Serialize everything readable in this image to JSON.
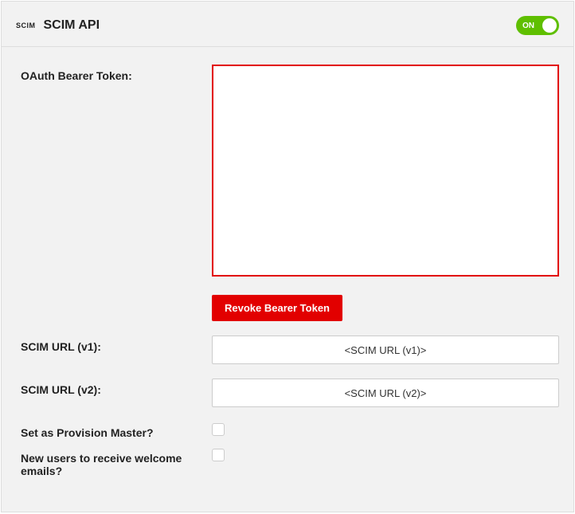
{
  "header": {
    "icon_text": "SCIM",
    "title": "SCIM API",
    "toggle": {
      "label": "ON",
      "on": true
    }
  },
  "form": {
    "token": {
      "label": "OAuth Bearer Token:",
      "value": "",
      "revoke_button": "Revoke Bearer Token"
    },
    "url_v1": {
      "label": "SCIM URL (v1):",
      "value": "<SCIM URL (v1)>"
    },
    "url_v2": {
      "label": "SCIM URL (v2):",
      "value": "<SCIM URL (v2)>"
    },
    "provision_master": {
      "label": "Set as Provision Master?",
      "checked": false
    },
    "welcome_emails": {
      "label": "New users to receive welcome emails?",
      "checked": false
    }
  }
}
